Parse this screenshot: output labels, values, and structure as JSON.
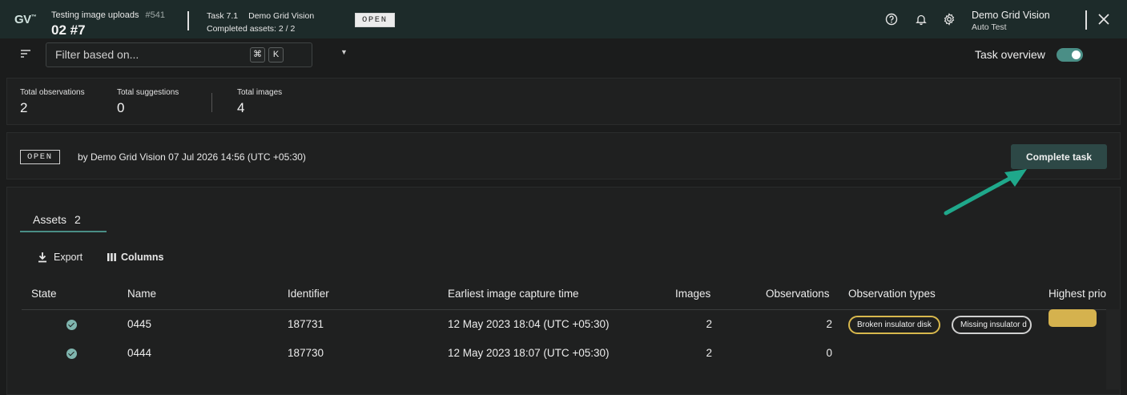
{
  "header": {
    "logo": "GV",
    "logo_mark": "™",
    "project_name": "Testing image uploads",
    "project_number": "#541",
    "project_big": "02 #7",
    "task_label": "Task 7.1",
    "task_name": "Demo Grid Vision",
    "completed_assets": "Completed assets: 2 / 2",
    "status_badge": "OPEN",
    "user_name": "Demo Grid Vision",
    "user_role": "Auto Test"
  },
  "filter": {
    "placeholder": "Filter based on...",
    "kbd_cmd": "⌘",
    "kbd_key": "K",
    "task_overview_label": "Task overview",
    "task_overview_on": true
  },
  "stats": [
    {
      "label": "Total observations",
      "value": "2"
    },
    {
      "label": "Total suggestions",
      "value": "0"
    },
    {
      "label": "Total images",
      "value": "4"
    }
  ],
  "status_panel": {
    "badge": "OPEN",
    "text": "by Demo Grid Vision 07 Jul 2026 14:56 (UTC +05:30)",
    "complete_button": "Complete task"
  },
  "assets": {
    "tab_label": "Assets",
    "tab_count": "2",
    "export_label": "Export",
    "columns_label": "Columns",
    "columns": [
      "State",
      "Name",
      "Identifier",
      "Earliest image capture time",
      "Images",
      "Observations",
      "Observation types",
      "Highest prio"
    ],
    "rows": [
      {
        "name": "0445",
        "identifier": "187731",
        "capture_time": "12 May 2023 18:04 (UTC +05:30)",
        "images": "2",
        "observations": "2",
        "types": [
          "Broken insulator disk",
          "Missing insulator d"
        ]
      },
      {
        "name": "0444",
        "identifier": "187730",
        "capture_time": "12 May 2023 18:07 (UTC +05:30)",
        "images": "2",
        "observations": "0",
        "types": []
      }
    ]
  },
  "colors": {
    "accent": "#4a8e86",
    "header_bg": "#1d2b2a",
    "arrow": "#1fa88b",
    "priority": "#d5b24e",
    "chip_yellow": "#d8b84d"
  }
}
